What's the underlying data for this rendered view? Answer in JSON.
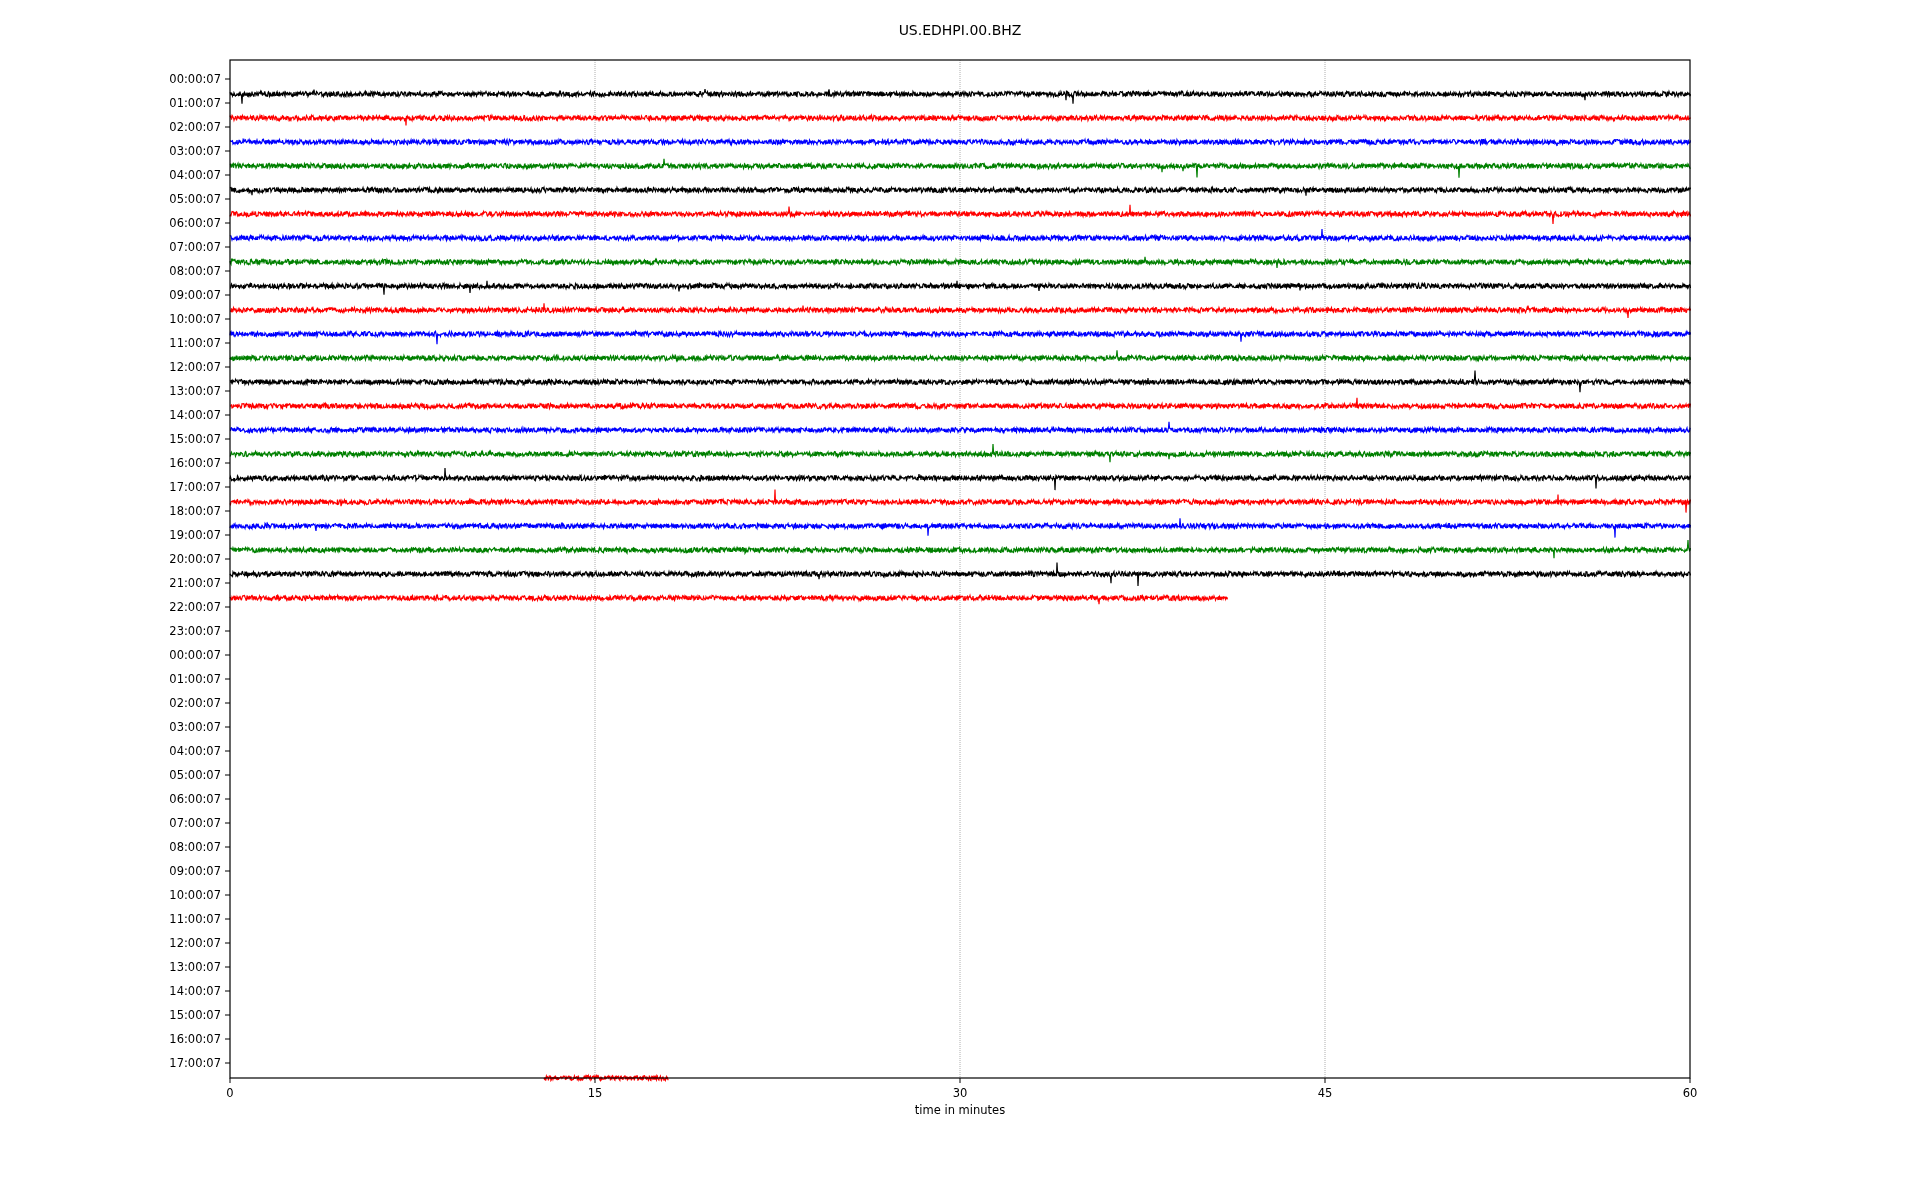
{
  "title": "US.EDHPI.00.BHZ",
  "plot": {
    "xlabel": "time in minutes",
    "xticks": [
      "0",
      "15",
      "30",
      "45",
      "60"
    ],
    "rows": [
      {
        "label": "00:00:07",
        "trace": {
          "color": "#000000",
          "level": 1
        }
      },
      {
        "label": "01:00:07",
        "trace": {
          "color": "#ff0000",
          "level": 1
        }
      },
      {
        "label": "02:00:07",
        "trace": {
          "color": "#0000ff",
          "level": 1
        }
      },
      {
        "label": "03:00:07",
        "trace": {
          "color": "#008000",
          "level": 1
        }
      },
      {
        "label": "04:00:07",
        "trace": {
          "color": "#000000",
          "level": 1
        }
      },
      {
        "label": "05:00:07",
        "trace": {
          "color": "#ff0000",
          "level": 1
        }
      },
      {
        "label": "06:00:07",
        "trace": {
          "color": "#0000ff",
          "level": 1
        }
      },
      {
        "label": "07:00:07",
        "trace": {
          "color": "#008000",
          "level": 1
        }
      },
      {
        "label": "08:00:07",
        "trace": {
          "color": "#000000",
          "level": 1
        }
      },
      {
        "label": "09:00:07",
        "trace": {
          "color": "#ff0000",
          "level": 1
        }
      },
      {
        "label": "10:00:07",
        "trace": {
          "color": "#0000ff",
          "level": 1
        }
      },
      {
        "label": "11:00:07",
        "trace": {
          "color": "#008000",
          "level": 1
        }
      },
      {
        "label": "12:00:07",
        "trace": {
          "color": "#000000",
          "level": 1
        }
      },
      {
        "label": "13:00:07",
        "trace": {
          "color": "#ff0000",
          "level": 1
        }
      },
      {
        "label": "14:00:07",
        "trace": {
          "color": "#0000ff",
          "level": 1
        }
      },
      {
        "label": "15:00:07",
        "trace": {
          "color": "#008000",
          "level": 1
        }
      },
      {
        "label": "16:00:07",
        "trace": {
          "color": "#000000",
          "level": 1
        }
      },
      {
        "label": "17:00:07",
        "trace": {
          "color": "#ff0000",
          "level": 1
        }
      },
      {
        "label": "18:00:07",
        "trace": {
          "color": "#0000ff",
          "level": 1
        }
      },
      {
        "label": "19:00:07",
        "trace": {
          "color": "#008000",
          "level": 1
        }
      },
      {
        "label": "20:00:07",
        "trace": {
          "color": "#000000",
          "level": 1
        }
      },
      {
        "label": "21:00:07",
        "trace": {
          "color": "#ff0000",
          "level": 0.683
        }
      },
      {
        "label": "22:00:07"
      },
      {
        "label": "23:00:07"
      },
      {
        "label": "00:00:07"
      },
      {
        "label": "01:00:07"
      },
      {
        "label": "02:00:07"
      },
      {
        "label": "03:00:07"
      },
      {
        "label": "04:00:07"
      },
      {
        "label": "05:00:07"
      },
      {
        "label": "06:00:07"
      },
      {
        "label": "07:00:07"
      },
      {
        "label": "08:00:07"
      },
      {
        "label": "09:00:07"
      },
      {
        "label": "10:00:07"
      },
      {
        "label": "11:00:07"
      },
      {
        "label": "12:00:07"
      },
      {
        "label": "13:00:07"
      },
      {
        "label": "14:00:07"
      },
      {
        "label": "15:00:07"
      },
      {
        "label": "16:00:07"
      },
      {
        "label": "17:00:07",
        "trace": {
          "color": "#ff0000",
          "level": 0.3,
          "lead_gap": {
            "level": 0.215
          }
        }
      }
    ]
  }
}
